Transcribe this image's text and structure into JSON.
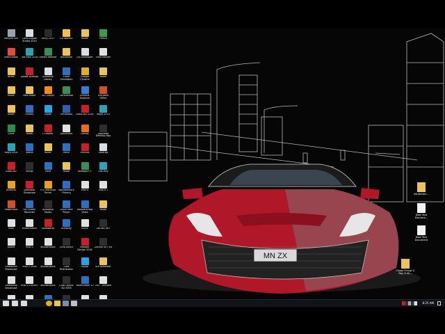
{
  "desktop": {
    "icons": [
      {
        "label": "Recycle Bin",
        "color": "#9aa4b0"
      },
      {
        "label": "Corel Digital Studio 2010",
        "color": "#d8dde3"
      },
      {
        "label": "Unity 2017",
        "color": "#2b2b2b"
      },
      {
        "label": "GX Works2",
        "color": "#f0c24a"
      },
      {
        "label": "folder",
        "color": "#e8c45a"
      },
      {
        "label": "Fresco",
        "color": "#3c9a48"
      },
      {
        "label": "Sketchbook",
        "color": "#e64a3a"
      },
      {
        "label": "3ds Max 2016",
        "color": "#2aa3b5"
      },
      {
        "label": "Dream Weaver",
        "color": "#3a8d5a"
      },
      {
        "label": "Bandicam",
        "color": "#e8c45a"
      },
      {
        "label": "GX Developer",
        "color": "#d8dde3"
      },
      {
        "label": "Foxit Reader",
        "color": "#e0e0e0"
      },
      {
        "label": "folder",
        "color": "#e8c45a"
      },
      {
        "label": "Adobe Acrobat",
        "color": "#c8202a"
      },
      {
        "label": "Autodesk Library",
        "color": "#d8dde3"
      },
      {
        "label": "Corel Simulation",
        "color": "#2e6fc0"
      },
      {
        "label": "Google Chrome",
        "color": "#e0b020"
      },
      {
        "label": "folder",
        "color": "#e8c45a"
      },
      {
        "label": "folder",
        "color": "#e8c45a"
      },
      {
        "label": "New folder",
        "color": "#e8c45a"
      },
      {
        "label": "VLC player",
        "color": "#f08a20"
      },
      {
        "label": "CorelDRAW",
        "color": "#3a8d5a"
      },
      {
        "label": "Internet Explorer",
        "color": "#3a7ad0"
      },
      {
        "label": "Microsoft Office",
        "color": "#d0502a"
      },
      {
        "label": "folder",
        "color": "#e8c45a"
      },
      {
        "label": "ShareX",
        "color": "#2e6fc0"
      },
      {
        "label": "Skype",
        "color": "#2aa3e5"
      },
      {
        "label": "VirtualBox",
        "color": "#2e5fb0"
      },
      {
        "label": "AutoCAD 2016",
        "color": "#c8202a"
      },
      {
        "label": "Maya 2015",
        "color": "#2aa3b5"
      },
      {
        "label": "Excel",
        "color": "#2e8a4a"
      },
      {
        "label": "folder",
        "color": "#e8c45a"
      },
      {
        "label": "CCleaner",
        "color": "#c8202a"
      },
      {
        "label": "Document",
        "color": "#e0e0e0"
      },
      {
        "label": "Firefox",
        "color": "#e07020"
      },
      {
        "label": "Autodesk Desktop App",
        "color": "#2e2e2e"
      },
      {
        "label": "Maya 2016",
        "color": "#2aa3b5"
      },
      {
        "label": "Works",
        "color": "#2e6fc0"
      },
      {
        "label": "folder",
        "color": "#e8c45a"
      },
      {
        "label": "Revit",
        "color": "#2e6fc0"
      },
      {
        "label": "FileZilla",
        "color": "#c8202a"
      },
      {
        "label": "Settings",
        "color": "#d8dde3"
      },
      {
        "label": "AutoCAD",
        "color": "#c8202a"
      },
      {
        "label": "Recap",
        "color": "#2e2e2e"
      },
      {
        "label": "Paint",
        "color": "#2e6fc0"
      },
      {
        "label": "folder",
        "color": "#e8c45a"
      },
      {
        "label": "Notepad++",
        "color": "#3a8d5a"
      },
      {
        "label": "3ds Max",
        "color": "#2aa3b5"
      },
      {
        "label": "Inventor",
        "color": "#e8a020"
      },
      {
        "label": "Autodesk Showcase",
        "color": "#c8202a"
      },
      {
        "label": "PTC Mathcad Prime",
        "color": "#e8a020"
      },
      {
        "label": "Wondershare Filmora",
        "color": "#2e6fc0"
      },
      {
        "label": "final 6",
        "color": "#e0e0e0"
      },
      {
        "label": "final 6 1",
        "color": "#e0e0e0"
      },
      {
        "label": "PowerPoint",
        "color": "#d0502a"
      },
      {
        "label": "My Screen Recorder",
        "color": "#2e6fc0"
      },
      {
        "label": "Autodesk Studio",
        "color": "#2e2e2e"
      },
      {
        "label": "QuickTime Player",
        "color": "#2e6fc0"
      },
      {
        "label": "Wondershare Video",
        "color": "#2e6fc0"
      },
      {
        "label": "folder",
        "color": "#e8c45a"
      },
      {
        "label": "final",
        "color": "#e0e0e0"
      },
      {
        "label": "shutterstock",
        "color": "#e0e0e0"
      },
      {
        "label": "SolidWorks",
        "color": "#c8202a"
      },
      {
        "label": "Audacity",
        "color": "#2e6fc0"
      },
      {
        "label": "BQ1x",
        "color": "#e0e0e0"
      },
      {
        "label": "ZBrush 4R7",
        "color": "#2e2e2e"
      },
      {
        "label": "ahand",
        "color": "#e0e0e0"
      },
      {
        "label": "final 3",
        "color": "#e0e0e0"
      },
      {
        "label": "shutterstock",
        "color": "#e0e0e0"
      },
      {
        "label": "Crea Direct",
        "color": "#2e2e2e"
      },
      {
        "label": "Realizer Design 2016",
        "color": "#c8202a"
      },
      {
        "label": "ZBrush 4R7 64",
        "color": "#2e2e2e"
      },
      {
        "label": "VideoHive Broadcast",
        "color": "#e0e0e0"
      },
      {
        "label": "final 2 2548",
        "color": "#e0e0e0"
      },
      {
        "label": "shutterstock",
        "color": "#e0e0e0"
      },
      {
        "label": "Crea Distribution",
        "color": "#2e2e2e"
      },
      {
        "label": "Skype",
        "color": "#2aa3e5"
      },
      {
        "label": "4th semester",
        "color": "#e8c45a"
      },
      {
        "label": "VideoHive Broadcast",
        "color": "#e0e0e0"
      },
      {
        "label": "final 2 234567",
        "color": "#e0e0e0"
      },
      {
        "label": "shutterstock",
        "color": "#e0e0e0"
      },
      {
        "label": "Crea Layout 3D 3055",
        "color": "#2e2e2e"
      },
      {
        "label": "TeamViewer 12",
        "color": "#2e6fc0"
      },
      {
        "label": "200 - Untitled",
        "color": "#e0e0e0"
      },
      {
        "label": "205 - shutterstock",
        "color": "#e0e0e0"
      },
      {
        "label": "giftwallacees text",
        "color": "#e0e0e0"
      },
      {
        "label": "shutterstock",
        "color": "#2e6fc0"
      },
      {
        "label": "Crea Modele Mesh",
        "color": "#2e2e2e"
      },
      {
        "label": "Marking Pro 8 Manual",
        "color": "#e0e0e0"
      },
      {
        "label": "155 0001 Drawing",
        "color": "#e0e0e0"
      },
      {
        "label": "111111",
        "color": "#e0e0e0"
      },
      {
        "label": "India",
        "color": "#e0e0e0"
      },
      {
        "label": "draft",
        "color": "#e0e0e0"
      }
    ],
    "right_icons": [
      {
        "label": "dkuttentic...",
        "color": "#e8c45a"
      },
      {
        "label": "New Text Docume...",
        "color": "#f2f2f2"
      },
      {
        "label": "New Text Document",
        "color": "#f2f2f2"
      },
      {
        "label": "Chaos Group V-Ray 3.40...",
        "color": "#e8c45a"
      }
    ]
  },
  "wallpaper": {
    "plate_text": "MN  ZX",
    "car_color": "#b0182a"
  },
  "taskbar": {
    "time": "8:25 AM",
    "items": [
      {
        "name": "start-button",
        "color": "#ffffff"
      },
      {
        "name": "cortana-button",
        "color": "#ffffff"
      },
      {
        "name": "task-view-button",
        "color": "#ffffff"
      },
      {
        "name": "chrome-taskbar-icon",
        "color": "#e0b020"
      },
      {
        "name": "explorer-taskbar-icon",
        "color": "#e8c45a"
      },
      {
        "name": "app-taskbar-icon",
        "color": "#7a8fa6"
      },
      {
        "name": "app2-taskbar-icon",
        "color": "#c0c0c0"
      }
    ]
  }
}
